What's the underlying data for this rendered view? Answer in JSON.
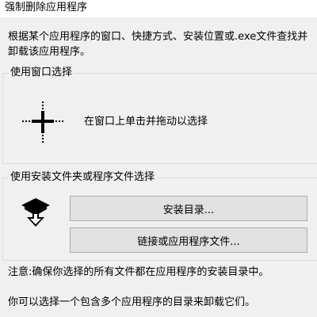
{
  "window": {
    "title": "强制删除应用程序"
  },
  "description": "根据某个应用程序的窗口、快捷方式、安装位置或.exe文件查找并卸载该应用程序。",
  "window_select": {
    "group_label": "使用窗口选择",
    "crosshair_icon": "crosshair-icon",
    "instruction": "在窗口上单击并拖动以选择"
  },
  "file_select": {
    "group_label": "使用安装文件夹或程序文件选择",
    "folder_icon": "uninstall-folder-icon",
    "install_dir_button": "安装目录...",
    "shortcut_button": "链接或应用程序文件..."
  },
  "notes": {
    "warning": "注意:确保你选择的所有文件都在应用程序的安装目录中。",
    "hint": "你可以选择一个包含多个应用程序的目录来卸载它们。"
  }
}
